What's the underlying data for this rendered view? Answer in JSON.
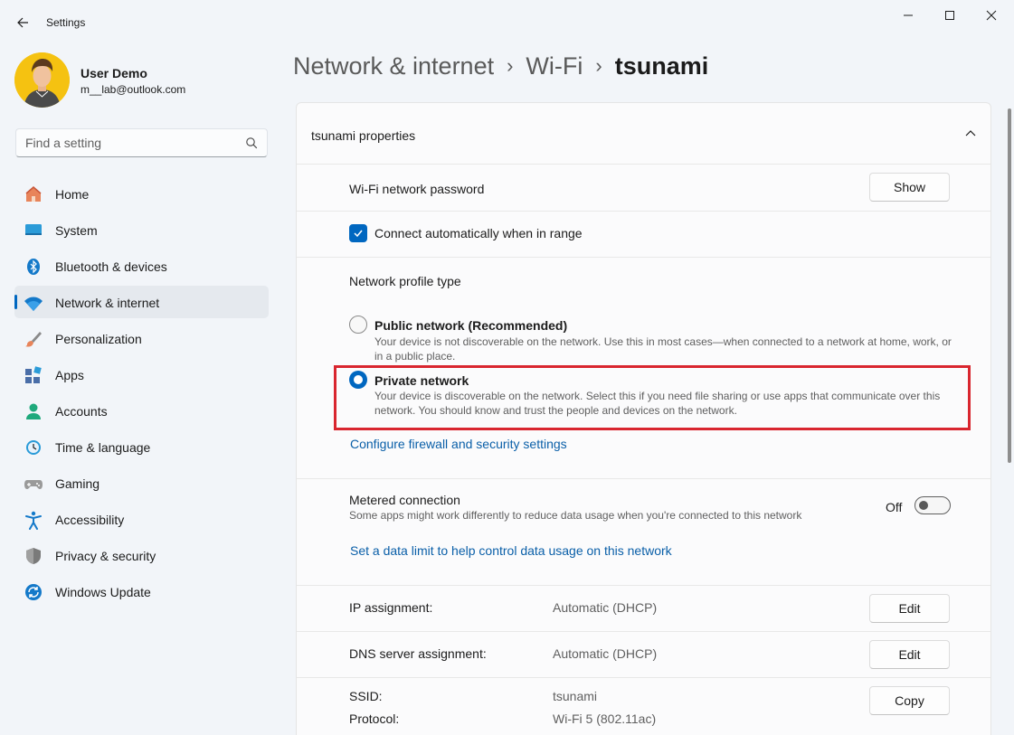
{
  "window": {
    "title": "Settings"
  },
  "user": {
    "name": "User Demo",
    "email": "m__lab@outlook.com"
  },
  "search": {
    "placeholder": "Find a setting"
  },
  "sidebar": {
    "items": [
      {
        "label": "Home",
        "icon": "home-icon"
      },
      {
        "label": "System",
        "icon": "system-icon"
      },
      {
        "label": "Bluetooth & devices",
        "icon": "bluetooth-icon"
      },
      {
        "label": "Network & internet",
        "icon": "wifi-icon",
        "active": true
      },
      {
        "label": "Personalization",
        "icon": "brush-icon"
      },
      {
        "label": "Apps",
        "icon": "apps-icon"
      },
      {
        "label": "Accounts",
        "icon": "accounts-icon"
      },
      {
        "label": "Time & language",
        "icon": "clock-icon"
      },
      {
        "label": "Gaming",
        "icon": "gamepad-icon"
      },
      {
        "label": "Accessibility",
        "icon": "accessibility-icon"
      },
      {
        "label": "Privacy & security",
        "icon": "shield-icon"
      },
      {
        "label": "Windows Update",
        "icon": "update-icon"
      }
    ]
  },
  "breadcrumb": {
    "parts": [
      "Network & internet",
      "Wi-Fi"
    ],
    "separator": "›",
    "current": "tsunami"
  },
  "properties": {
    "title": "tsunami properties",
    "wifi_password_label": "Wi-Fi network password",
    "show_button": "Show",
    "connect_auto_label": "Connect automatically when in range",
    "connect_auto_checked": true,
    "profile_type_label": "Network profile type",
    "public": {
      "title": "Public network (Recommended)",
      "description": "Your device is not discoverable on the network. Use this in most cases—when connected to a network at home, work, or in a public place.",
      "selected": false
    },
    "private": {
      "title": "Private network",
      "description": "Your device is discoverable on the network. Select this if you need file sharing or use apps that communicate over this network. You should know and trust the people and devices on the network.",
      "selected": true
    },
    "firewall_link": "Configure firewall and security settings",
    "metered": {
      "label": "Metered connection",
      "description": "Some apps might work differently to reduce data usage when you're connected to this network",
      "state_label": "Off",
      "on": false
    },
    "data_limit_link": "Set a data limit to help control data usage on this network",
    "ip_assignment": {
      "label": "IP assignment:",
      "value": "Automatic (DHCP)",
      "button": "Edit"
    },
    "dns_assignment": {
      "label": "DNS server assignment:",
      "value": "Automatic (DHCP)",
      "button": "Edit"
    },
    "ssid": {
      "label": "SSID:",
      "value": "tsunami",
      "button": "Copy"
    },
    "protocol": {
      "label": "Protocol:",
      "value": "Wi-Fi 5 (802.11ac)"
    }
  },
  "colors": {
    "accent": "#0067c0",
    "highlight": "#d9262f",
    "link": "#0a5fa8",
    "background": "#f2f5f9"
  }
}
